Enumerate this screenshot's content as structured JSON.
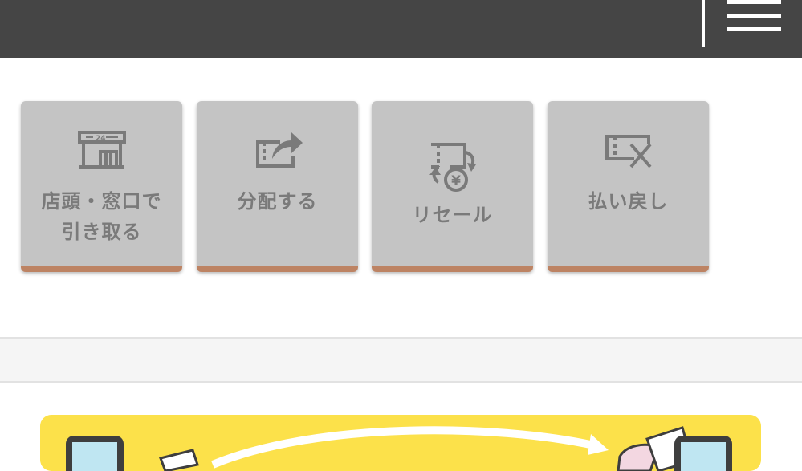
{
  "header": {
    "menu_icon": "hamburger-menu-icon",
    "background": "#454545"
  },
  "actions": [
    {
      "id": "store-pickup",
      "label_line1": "店頭・窓口で",
      "label_line2": "引き取る",
      "icon": "store-24h-icon"
    },
    {
      "id": "distribute",
      "label_line1": "分配する",
      "icon": "ticket-share-icon"
    },
    {
      "id": "resale",
      "label_line1": "リセール",
      "icon": "ticket-yen-exchange-icon"
    },
    {
      "id": "refund",
      "label_line1": "払い戻し",
      "icon": "ticket-cancel-icon"
    }
  ],
  "store_icon_text": "24",
  "resale_icon_text": "¥",
  "colors": {
    "tile_bg": "#c4c4c4",
    "tile_accent": "#bd8363",
    "tile_text": "#7a7a7a",
    "banner": "#fce14a"
  }
}
